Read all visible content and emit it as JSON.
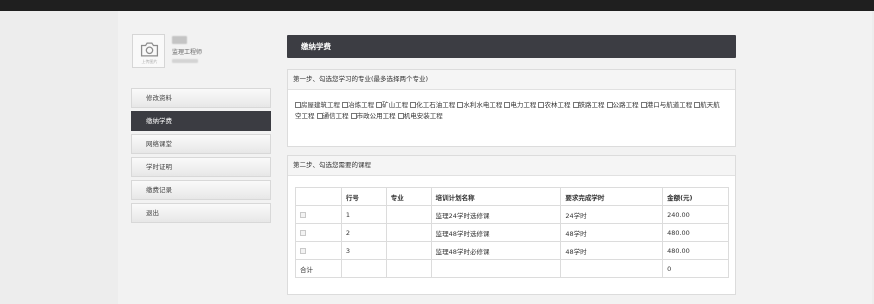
{
  "profile": {
    "avatar_caption": "上传图片",
    "role": "监理工程师"
  },
  "sidebar": {
    "items": [
      {
        "label": "修改资料",
        "active": false
      },
      {
        "label": "缴纳学费",
        "active": true
      },
      {
        "label": "网络课堂",
        "active": false
      },
      {
        "label": "学时证明",
        "active": false
      },
      {
        "label": "缴费记录",
        "active": false
      },
      {
        "label": "退出",
        "active": false
      }
    ]
  },
  "main": {
    "header": "缴纳学费",
    "step1": {
      "title": "第一步、勾选您学习的专业(最多选择两个专业)",
      "majors": [
        "房屋建筑工程",
        "冶炼工程",
        "矿山工程",
        "化工石油工程",
        "水利水电工程",
        "电力工程",
        "农林工程",
        "铁路工程",
        "公路工程",
        "港口与航道工程",
        "航天航空工程",
        "通信工程",
        "市政公用工程",
        "机电安装工程"
      ]
    },
    "step2": {
      "title": "第二步、勾选您需要的课程",
      "columns": [
        "",
        "行号",
        "专业",
        "培训计划名称",
        "要求完成学时",
        "金额(元)"
      ],
      "rows": [
        {
          "no": "1",
          "major": "",
          "plan": "监理24学时选修课",
          "hours": "24学时",
          "amount": "240.00"
        },
        {
          "no": "2",
          "major": "",
          "plan": "监理48学时选修课",
          "hours": "48学时",
          "amount": "480.00"
        },
        {
          "no": "3",
          "major": "",
          "plan": "监理48学时必修课",
          "hours": "48学时",
          "amount": "480.00"
        }
      ],
      "total_label": "合计",
      "total_amount": "0"
    }
  },
  "colors": {
    "topbar": "#1f1f1f",
    "accent_dark": "#3c3d43",
    "page_bg": "#f2f2f2"
  },
  "icons": {
    "avatar": "camera-icon"
  }
}
